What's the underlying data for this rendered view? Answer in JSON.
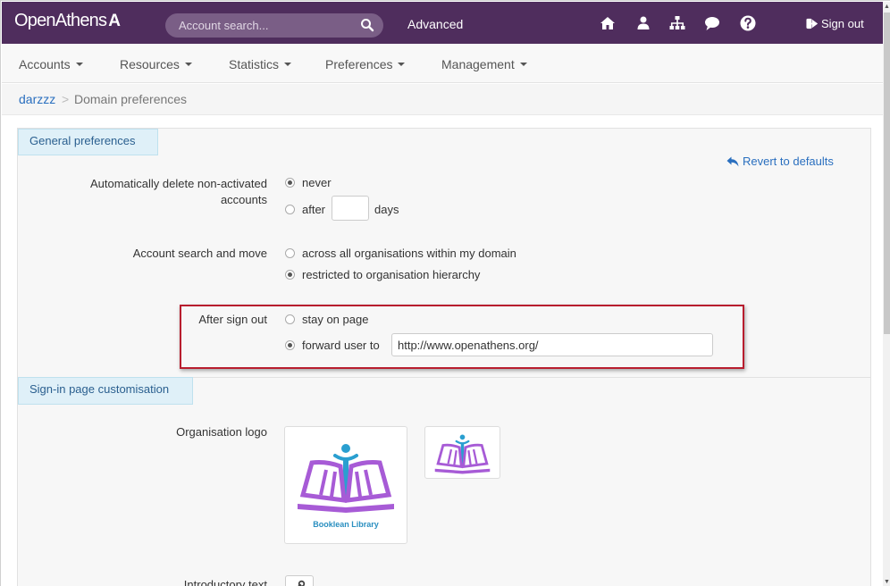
{
  "header": {
    "logo_text": "OpenAthens",
    "logo_mark": "A",
    "search_placeholder": "Account search...",
    "advanced_label": "Advanced",
    "icons": [
      "home-icon",
      "user-icon",
      "sitemap-icon",
      "comment-icon",
      "help-icon"
    ],
    "signout_label": "Sign out"
  },
  "nav": {
    "items": [
      {
        "label": "Accounts"
      },
      {
        "label": "Resources"
      },
      {
        "label": "Statistics"
      },
      {
        "label": "Preferences"
      },
      {
        "label": "Management"
      }
    ]
  },
  "breadcrumb": {
    "root": "darzzz",
    "separator": ">",
    "current": "Domain preferences"
  },
  "general": {
    "tab_label": "General preferences",
    "revert_label": "Revert to defaults",
    "delete": {
      "label_line1": "Automatically delete non-activated",
      "label_line2": "accounts",
      "opt_never": "never",
      "opt_after": "after",
      "days_value": "",
      "days_suffix": "days",
      "selected": "never"
    },
    "search_move": {
      "label": "Account search and move",
      "opt_all": "across all organisations within my domain",
      "opt_restricted": "restricted to organisation hierarchy",
      "selected": "restricted"
    },
    "after_signout": {
      "label": "After sign out",
      "opt_stay": "stay on page",
      "opt_forward": "forward user to",
      "url_value": "http://www.openathens.org/",
      "selected": "forward"
    }
  },
  "signin": {
    "tab_label": "Sign-in page customisation",
    "logo_label": "Organisation logo",
    "logo_caption": "Booklean Library",
    "intro_label": "Introductory text"
  },
  "colors": {
    "header_bg": "#4f2d5d",
    "link": "#2a6fbf",
    "highlight": "#b81d2e",
    "logo_purple": "#a75bd6",
    "logo_blue": "#2a9fd0"
  }
}
